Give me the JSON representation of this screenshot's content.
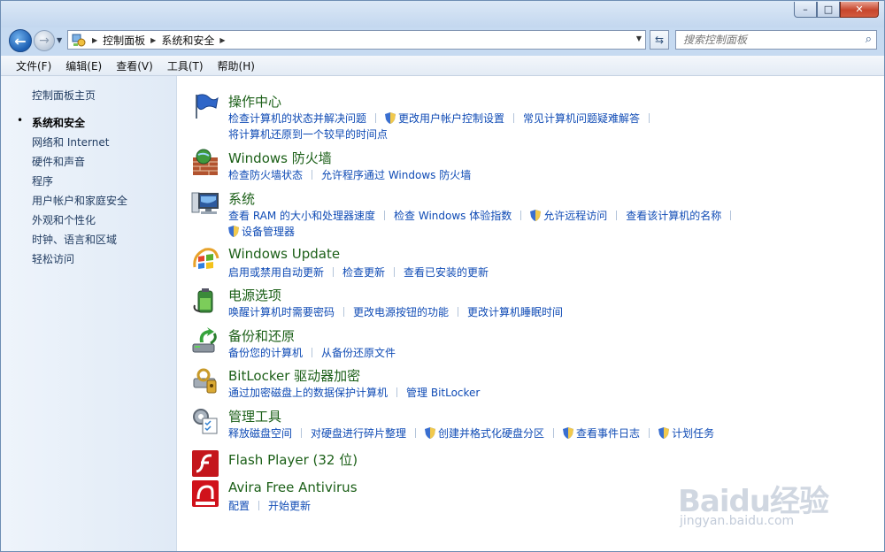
{
  "window": {
    "caption_min": "–",
    "caption_max": "□",
    "caption_close": "✕"
  },
  "navigation": {
    "breadcrumbs": [
      "控制面板",
      "系统和安全"
    ],
    "search_placeholder": "搜索控制面板"
  },
  "menu": [
    "文件(F)",
    "编辑(E)",
    "查看(V)",
    "工具(T)",
    "帮助(H)"
  ],
  "sidebar": {
    "home": "控制面板主页",
    "items": [
      {
        "label": "系统和安全",
        "current": true
      },
      {
        "label": "网络和 Internet",
        "current": false
      },
      {
        "label": "硬件和声音",
        "current": false
      },
      {
        "label": "程序",
        "current": false
      },
      {
        "label": "用户帐户和家庭安全",
        "current": false
      },
      {
        "label": "外观和个性化",
        "current": false
      },
      {
        "label": "时钟、语言和区域",
        "current": false
      },
      {
        "label": "轻松访问",
        "current": false
      }
    ]
  },
  "categories": [
    {
      "title": "操作中心",
      "icon": "action-center-flag-icon",
      "links": [
        {
          "label": "检查计算机的状态并解决问题",
          "shield": false
        },
        {
          "label": "更改用户帐户控制设置",
          "shield": true
        },
        {
          "label": "常见计算机问题疑难解答",
          "shield": false
        },
        {
          "label": "将计算机还原到一个较早的时间点",
          "shield": false
        }
      ]
    },
    {
      "title": "Windows 防火墙",
      "icon": "firewall-icon",
      "links": [
        {
          "label": "检查防火墙状态",
          "shield": false
        },
        {
          "label": "允许程序通过 Windows 防火墙",
          "shield": false
        }
      ]
    },
    {
      "title": "系统",
      "icon": "system-computer-icon",
      "links": [
        {
          "label": "查看 RAM 的大小和处理器速度",
          "shield": false
        },
        {
          "label": "检查 Windows 体验指数",
          "shield": false
        },
        {
          "label": "允许远程访问",
          "shield": true
        },
        {
          "label": "查看该计算机的名称",
          "shield": false
        },
        {
          "label": "设备管理器",
          "shield": true
        }
      ]
    },
    {
      "title": "Windows Update",
      "icon": "windows-update-icon",
      "links": [
        {
          "label": "启用或禁用自动更新",
          "shield": false
        },
        {
          "label": "检查更新",
          "shield": false
        },
        {
          "label": "查看已安装的更新",
          "shield": false
        }
      ]
    },
    {
      "title": "电源选项",
      "icon": "power-options-icon",
      "links": [
        {
          "label": "唤醒计算机时需要密码",
          "shield": false
        },
        {
          "label": "更改电源按钮的功能",
          "shield": false
        },
        {
          "label": "更改计算机睡眠时间",
          "shield": false
        }
      ]
    },
    {
      "title": "备份和还原",
      "icon": "backup-restore-icon",
      "links": [
        {
          "label": "备份您的计算机",
          "shield": false
        },
        {
          "label": "从备份还原文件",
          "shield": false
        }
      ]
    },
    {
      "title": "BitLocker 驱动器加密",
      "icon": "bitlocker-icon",
      "links": [
        {
          "label": "通过加密磁盘上的数据保护计算机",
          "shield": false
        },
        {
          "label": "管理 BitLocker",
          "shield": false
        }
      ]
    },
    {
      "title": "管理工具",
      "icon": "admin-tools-icon",
      "links": [
        {
          "label": "释放磁盘空间",
          "shield": false
        },
        {
          "label": "对硬盘进行碎片整理",
          "shield": false
        },
        {
          "label": "创建并格式化硬盘分区",
          "shield": true
        },
        {
          "label": "查看事件日志",
          "shield": true
        },
        {
          "label": "计划任务",
          "shield": true
        }
      ]
    },
    {
      "title": "Flash Player (32 位)",
      "icon": "flash-player-icon",
      "links": []
    },
    {
      "title": "Avira Free Antivirus",
      "icon": "avira-icon",
      "links": [
        {
          "label": "配置",
          "shield": false
        },
        {
          "label": "开始更新",
          "shield": false
        }
      ]
    }
  ],
  "watermark": {
    "brand": "Baidu经验",
    "url": "jingyan.baidu.com"
  }
}
